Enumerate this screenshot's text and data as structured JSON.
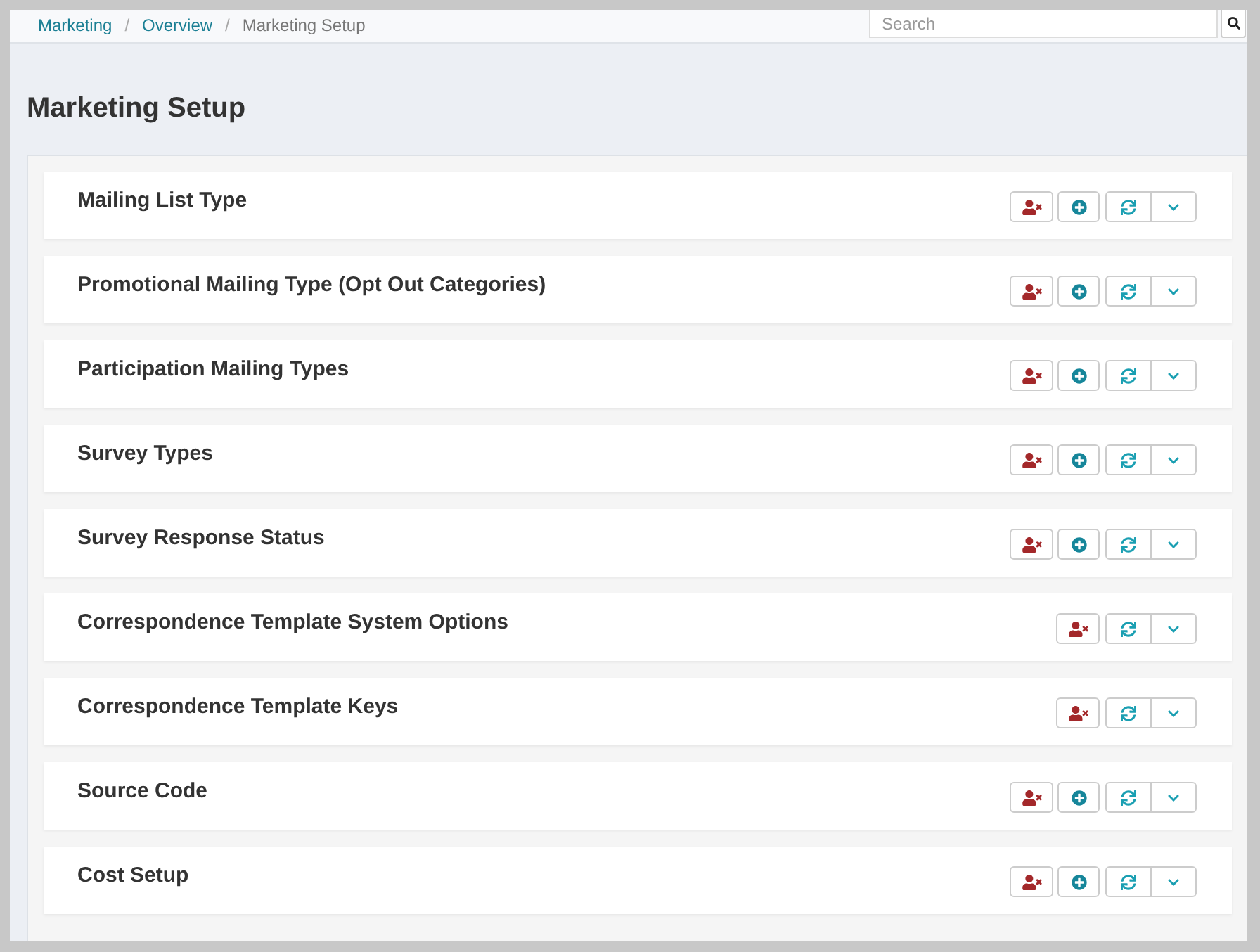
{
  "breadcrumb": [
    {
      "label": "Marketing",
      "kind": "link"
    },
    {
      "label": "/",
      "kind": "separator"
    },
    {
      "label": "Overview",
      "kind": "link"
    },
    {
      "label": "/",
      "kind": "separator"
    },
    {
      "label": "Marketing Setup",
      "kind": "current"
    }
  ],
  "search": {
    "placeholder": "Search"
  },
  "title": "Marketing Setup",
  "sections": [
    {
      "title": "Mailing List Type",
      "buttons": [
        {
          "kind": "remove"
        },
        {
          "kind": "add"
        },
        {
          "kind": "refresh"
        },
        {
          "kind": "expand"
        }
      ]
    },
    {
      "title": "Promotional Mailing Type (Opt Out Categories)",
      "buttons": [
        {
          "kind": "remove"
        },
        {
          "kind": "add"
        },
        {
          "kind": "refresh"
        },
        {
          "kind": "expand"
        }
      ]
    },
    {
      "title": "Participation Mailing Types",
      "buttons": [
        {
          "kind": "remove"
        },
        {
          "kind": "add"
        },
        {
          "kind": "refresh"
        },
        {
          "kind": "expand"
        }
      ]
    },
    {
      "title": "Survey Types",
      "buttons": [
        {
          "kind": "remove"
        },
        {
          "kind": "add"
        },
        {
          "kind": "refresh"
        },
        {
          "kind": "expand"
        }
      ]
    },
    {
      "title": "Survey Response Status",
      "buttons": [
        {
          "kind": "remove"
        },
        {
          "kind": "add"
        },
        {
          "kind": "refresh"
        },
        {
          "kind": "expand"
        }
      ]
    },
    {
      "title": "Correspondence Template System Options",
      "buttons": [
        {
          "kind": "remove"
        },
        {
          "kind": "refresh"
        },
        {
          "kind": "expand"
        }
      ]
    },
    {
      "title": "Correspondence Template Keys",
      "buttons": [
        {
          "kind": "remove"
        },
        {
          "kind": "refresh"
        },
        {
          "kind": "expand"
        }
      ]
    },
    {
      "title": "Source Code",
      "buttons": [
        {
          "kind": "remove"
        },
        {
          "kind": "add"
        },
        {
          "kind": "refresh"
        },
        {
          "kind": "expand"
        }
      ]
    },
    {
      "title": "Cost Setup",
      "buttons": [
        {
          "kind": "remove"
        },
        {
          "kind": "add"
        },
        {
          "kind": "refresh"
        },
        {
          "kind": "expand"
        }
      ]
    }
  ]
}
